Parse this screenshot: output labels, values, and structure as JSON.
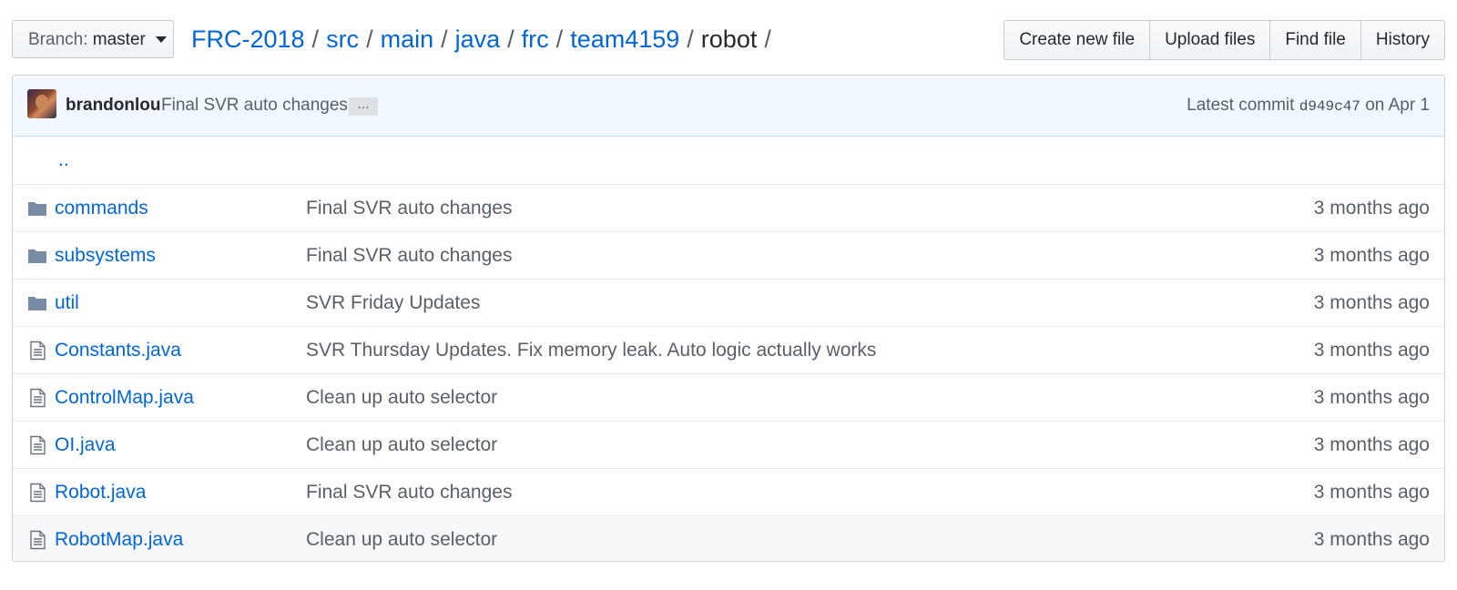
{
  "branch": {
    "label": "Branch:",
    "value": "master"
  },
  "breadcrumb": {
    "items": [
      "FRC-2018",
      "src",
      "main",
      "java",
      "frc",
      "team4159"
    ],
    "current": "robot",
    "separator": "/"
  },
  "actions": {
    "create": "Create new file",
    "upload": "Upload files",
    "find": "Find file",
    "history": "History"
  },
  "commit": {
    "author": "brandonlou",
    "message": "Final SVR auto changes",
    "ellipsis": "…",
    "latest_label": "Latest commit",
    "sha": "d949c47",
    "date": "on Apr 1"
  },
  "parent_link": "..",
  "files": [
    {
      "type": "folder",
      "icon": "folder-icon",
      "name": "commands",
      "message": "Final SVR auto changes",
      "age": "3 months ago"
    },
    {
      "type": "folder",
      "icon": "folder-icon",
      "name": "subsystems",
      "message": "Final SVR auto changes",
      "age": "3 months ago"
    },
    {
      "type": "folder",
      "icon": "folder-icon",
      "name": "util",
      "message": "SVR Friday Updates",
      "age": "3 months ago"
    },
    {
      "type": "file",
      "icon": "file-icon",
      "name": "Constants.java",
      "message": "SVR Thursday Updates. Fix memory leak. Auto logic actually works",
      "age": "3 months ago"
    },
    {
      "type": "file",
      "icon": "file-icon",
      "name": "ControlMap.java",
      "message": "Clean up auto selector",
      "age": "3 months ago"
    },
    {
      "type": "file",
      "icon": "file-icon",
      "name": "OI.java",
      "message": "Clean up auto selector",
      "age": "3 months ago"
    },
    {
      "type": "file",
      "icon": "file-icon",
      "name": "Robot.java",
      "message": "Final SVR auto changes",
      "age": "3 months ago"
    },
    {
      "type": "file",
      "icon": "file-icon",
      "name": "RobotMap.java",
      "message": "Clean up auto selector",
      "age": "3 months ago"
    }
  ],
  "colors": {
    "link": "#0366d6",
    "muted": "#586069",
    "icon": "#6a7f9a",
    "commit_bg": "#f1f8ff"
  }
}
